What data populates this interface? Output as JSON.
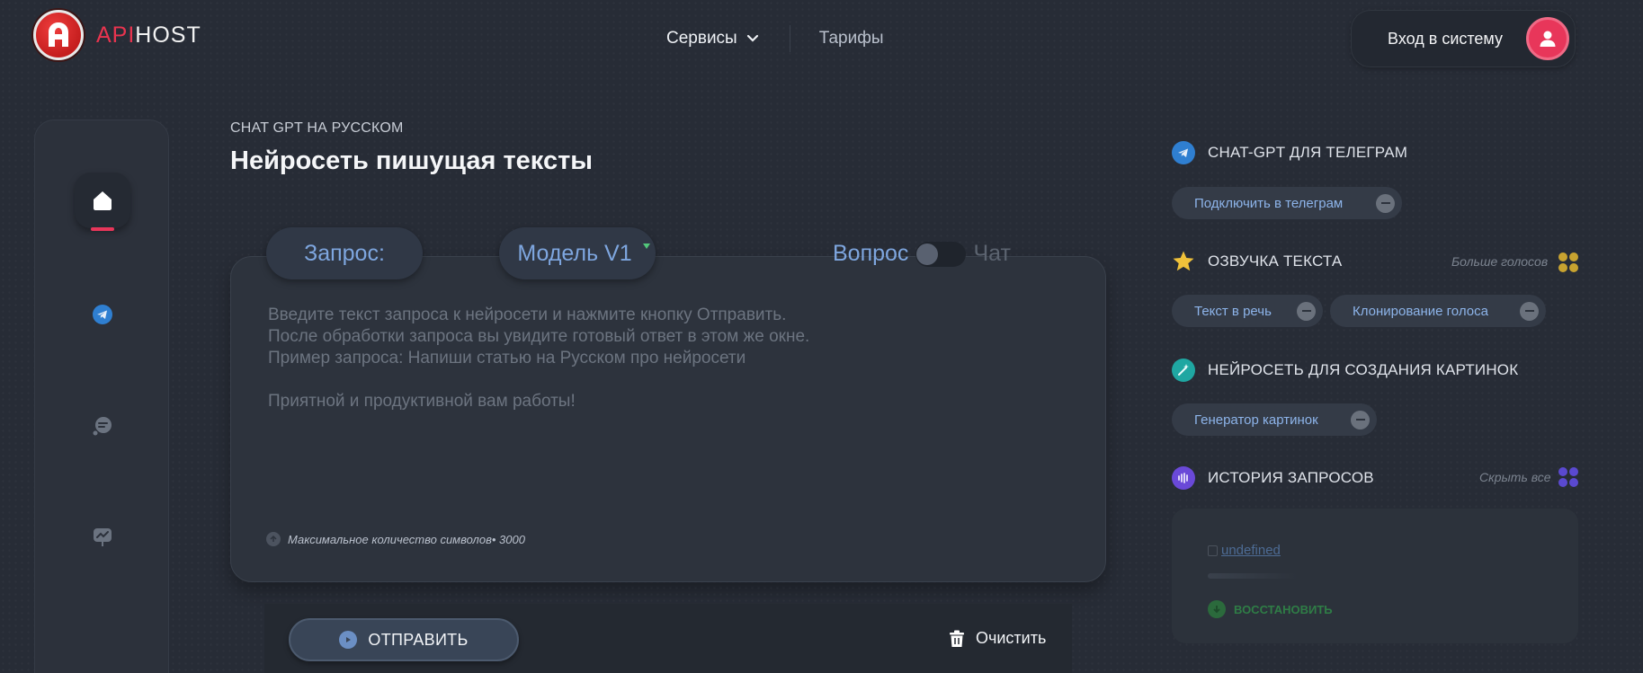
{
  "brand": {
    "prefix": "API",
    "suffix": "HOST",
    "accent_color": "#e8344f"
  },
  "nav": {
    "services_label": "Сервисы",
    "pricing_label": "Тарифы"
  },
  "login": {
    "label": "Вход в систему"
  },
  "sidebar": {
    "items": [
      {
        "icon": "home-icon",
        "active": true
      },
      {
        "icon": "telegram-icon",
        "active": false
      },
      {
        "icon": "chat-bubbles-icon",
        "active": false
      },
      {
        "icon": "presentation-icon",
        "active": false
      }
    ]
  },
  "main": {
    "subtitle": "CHAT GPT НА РУССКОМ",
    "title": "Нейросеть пишущая тексты",
    "request_label": "Запрос:",
    "model_label": "Модель V1",
    "mode_question": "Вопрос",
    "mode_chat": "Чат",
    "prompt_placeholder": "Введите текст запроса к нейросети и нажмите кнопку Отправить.\nПосле обработки запроса вы увидите готовый ответ в этом же окне.\nПример запроса: Напиши статью на Русском про нейросети\n\nПриятной и продуктивной вам работы!",
    "char_limit_label": "Максимальное количество символов",
    "char_limit_value": "• 3000",
    "send_label": "ОТПРАВИТЬ",
    "clear_label": "Очистить"
  },
  "right": {
    "telegram": {
      "title": "CHAT-GPT ДЛЯ ТЕЛЕГРАМ",
      "chip": "Подключить в телеграм"
    },
    "voice": {
      "title": "ОЗВУЧКА ТЕКСТА",
      "note": "Больше голосов",
      "chips": [
        "Текст в речь",
        "Клонирование голоса"
      ]
    },
    "images": {
      "title": "НЕЙРОСЕТЬ ДЛЯ СОЗДАНИЯ КАРТИНОК",
      "chip": "Генератор картинок"
    },
    "history": {
      "title": "ИСТОРИЯ ЗАПРОСОВ",
      "note": "Скрыть все",
      "item": "undefined",
      "restore_label": "ВОССТАНОВИТЬ"
    }
  },
  "colors": {
    "background": "#272c36",
    "accent_blue": "#7ea6df",
    "accent_red": "#e8365a",
    "restore_green": "#2f7d46"
  }
}
